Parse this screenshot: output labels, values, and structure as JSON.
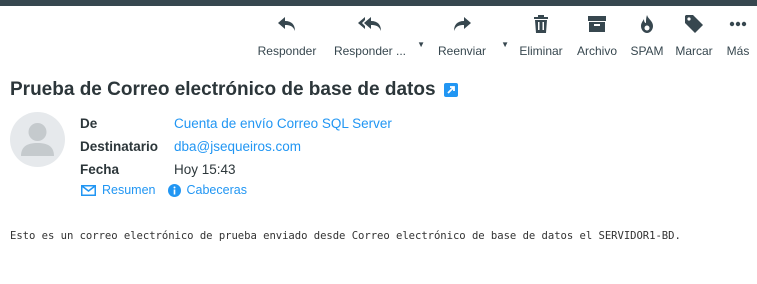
{
  "toolbar": {
    "buttons": [
      {
        "label": "Responder",
        "icon": "reply-icon"
      },
      {
        "label": "Responder ...",
        "icon": "reply-all-icon"
      },
      {
        "label": "Reenviar",
        "icon": "forward-icon"
      },
      {
        "label": "Eliminar",
        "icon": "trash-icon"
      },
      {
        "label": "Archivo",
        "icon": "archive-icon"
      },
      {
        "label": "SPAM",
        "icon": "fire-icon"
      },
      {
        "label": "Marcar",
        "icon": "tag-icon"
      },
      {
        "label": "Más",
        "icon": "more-icon"
      }
    ]
  },
  "message": {
    "subject": "Prueba de Correo electrónico de base de datos",
    "from_label": "De",
    "from_value": "Cuenta de envío Correo SQL Server",
    "to_label": "Destinatario",
    "to_value": "dba@jsequeiros.com",
    "date_label": "Fecha",
    "date_value": "Hoy 15:43",
    "summary_link": "Resumen",
    "headers_link": "Cabeceras",
    "body": "Esto es un correo electrónico de prueba enviado desde Correo electrónico de base de datos el SERVIDOR1-BD."
  },
  "colors": {
    "accent": "#2196f3",
    "toolbar_icon": "#37474f",
    "top_bar": "#37474f"
  }
}
